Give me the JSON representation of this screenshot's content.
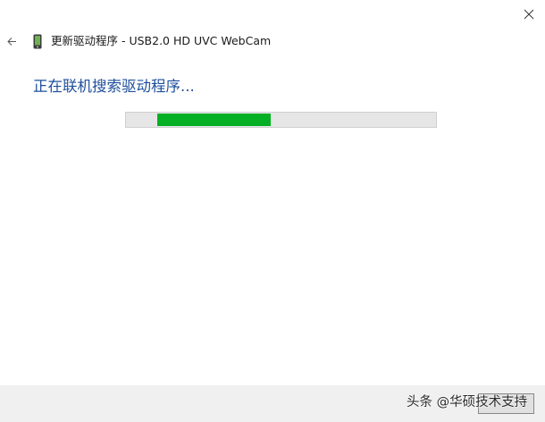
{
  "window": {
    "title": "更新驱动程序 - USB2.0 HD UVC WebCam",
    "close_icon": "close-icon",
    "back_icon": "back-arrow-icon",
    "device_icon": "phone-device-icon"
  },
  "main": {
    "heading": "正在联机搜索驱动程序...",
    "progress": {
      "start_fraction": 0.1,
      "end_fraction": 0.465,
      "fill_color": "#06b025"
    }
  },
  "footer": {
    "watermark": "头条 @华硕技术支持"
  },
  "colors": {
    "heading": "#1e4e9c",
    "progress_fill": "#06b025",
    "progress_track": "#e6e6e6",
    "footer_bg": "#f0f0f0"
  }
}
